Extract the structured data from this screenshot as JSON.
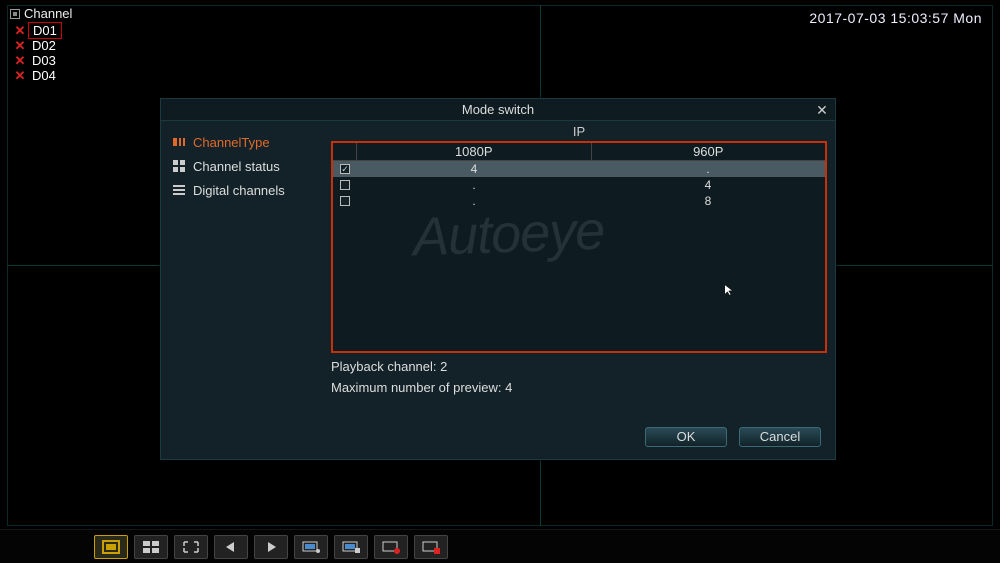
{
  "timestamp": "2017-07-03 15:03:57 Mon",
  "channel_panel": {
    "header": "Channel",
    "items": [
      {
        "label": "D01",
        "selected": true
      },
      {
        "label": "D02",
        "selected": false
      },
      {
        "label": "D03",
        "selected": false
      },
      {
        "label": "D04",
        "selected": false
      }
    ]
  },
  "dialog": {
    "title": "Mode switch",
    "sidebar": [
      {
        "label": "ChannelType",
        "active": true
      },
      {
        "label": "Channel status",
        "active": false
      },
      {
        "label": "Digital channels",
        "active": false
      }
    ],
    "table": {
      "group_label": "IP",
      "headers": {
        "c1080": "1080P",
        "c960": "960P"
      },
      "rows": [
        {
          "checked": true,
          "c1080": "4",
          "c960": ".",
          "selected": true
        },
        {
          "checked": false,
          "c1080": ".",
          "c960": "4",
          "selected": false
        },
        {
          "checked": false,
          "c1080": ".",
          "c960": "8",
          "selected": false
        }
      ]
    },
    "watermark": "Autoeye",
    "info1_label": "Playback channel: ",
    "info1_value": "2",
    "info2_label": "Maximum number of preview: ",
    "info2_value": "4",
    "ok_label": "OK",
    "cancel_label": "Cancel"
  },
  "toolbar_icons": [
    "single-view-icon",
    "quad-view-icon",
    "fullscreen-icon",
    "prev-icon",
    "next-icon",
    "monitor1-icon",
    "monitor2-icon",
    "record-icon",
    "stop-record-icon"
  ]
}
